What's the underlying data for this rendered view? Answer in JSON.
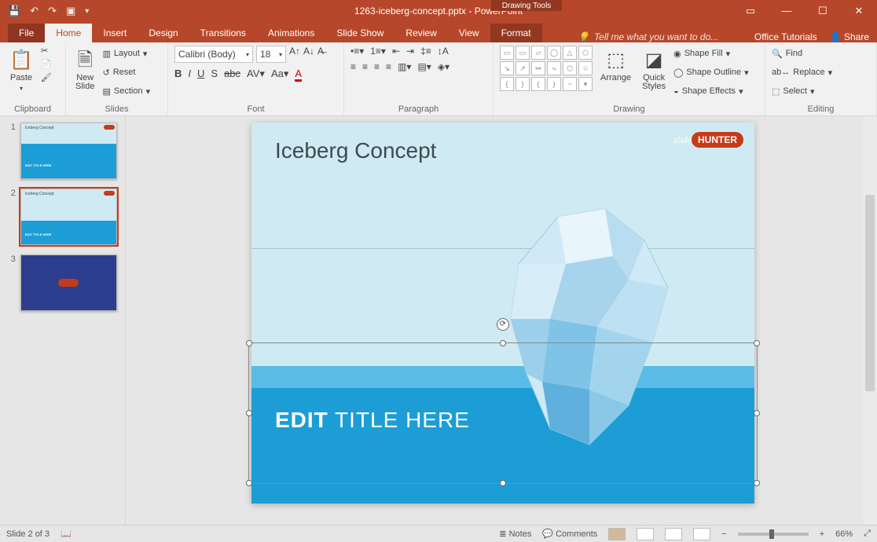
{
  "title": {
    "doc": "1263-iceberg-concept.pptx",
    "app": "PowerPoint",
    "tools_context": "Drawing Tools"
  },
  "tabs": {
    "file": "File",
    "home": "Home",
    "insert": "Insert",
    "design": "Design",
    "transitions": "Transitions",
    "animations": "Animations",
    "slideshow": "Slide Show",
    "review": "Review",
    "view": "View",
    "format": "Format",
    "tell": "Tell me what you want to do...",
    "tutorials": "Office Tutorials",
    "share": "Share"
  },
  "ribbon": {
    "clipboard": {
      "paste": "Paste",
      "label": "Clipboard"
    },
    "slides": {
      "new": "New\nSlide",
      "layout": "Layout",
      "reset": "Reset",
      "section": "Section",
      "label": "Slides"
    },
    "font": {
      "family": "Calibri (Body)",
      "size": "18",
      "label": "Font"
    },
    "paragraph": {
      "label": "Paragraph"
    },
    "drawing": {
      "arrange": "Arrange",
      "quick": "Quick\nStyles",
      "fill": "Shape Fill",
      "outline": "Shape Outline",
      "effects": "Shape Effects",
      "label": "Drawing"
    },
    "editing": {
      "find": "Find",
      "replace": "Replace",
      "select": "Select",
      "label": "Editing"
    }
  },
  "slide": {
    "title": "Iceberg Concept",
    "edit_bold": "EDIT",
    "edit_rest": " TITLE HERE",
    "logo_pre": "slide",
    "logo_main": "HUNTER"
  },
  "thumbs": [
    1,
    2,
    3
  ],
  "status": {
    "slide": "Slide 2 of 3",
    "notes": "Notes",
    "comments": "Comments",
    "zoom": "66%"
  }
}
